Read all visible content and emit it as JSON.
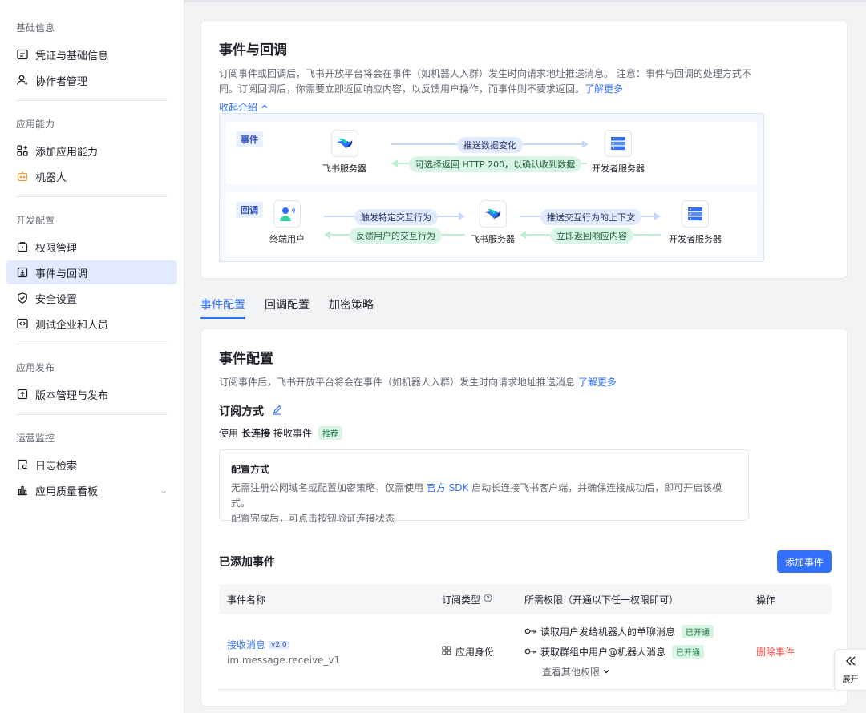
{
  "sidebar": {
    "groups": [
      {
        "title": "基础信息",
        "items": [
          {
            "label": "凭证与基础信息",
            "icon": "id-card-icon"
          },
          {
            "label": "协作者管理",
            "icon": "user-add-icon"
          }
        ]
      },
      {
        "title": "应用能力",
        "items": [
          {
            "label": "添加应用能力",
            "icon": "apps-add-icon"
          },
          {
            "label": "机器人",
            "icon": "robot-icon"
          }
        ]
      },
      {
        "title": "开发配置",
        "items": [
          {
            "label": "权限管理",
            "icon": "permission-icon"
          },
          {
            "label": "事件与回调",
            "icon": "event-icon",
            "active": true
          },
          {
            "label": "安全设置",
            "icon": "shield-icon"
          },
          {
            "label": "测试企业和人员",
            "icon": "code-icon"
          }
        ]
      },
      {
        "title": "应用发布",
        "items": [
          {
            "label": "版本管理与发布",
            "icon": "upload-icon"
          }
        ]
      },
      {
        "title": "运营监控",
        "items": [
          {
            "label": "日志检索",
            "icon": "log-search-icon"
          },
          {
            "label": "应用质量看板",
            "icon": "bar-chart-icon",
            "chevron": true
          }
        ]
      }
    ]
  },
  "intro": {
    "title": "事件与回调",
    "desc": "订阅事件或回调后，飞书开放平台将会在事件（如机器人入群）发生时向请求地址推送消息。 注意：事件与回调的处理方式不同。订阅回调后，你需要立即返回响应内容，以反馈用户操作，而事件则不要求返回。",
    "learn_more": "了解更多",
    "collapse": "收起介绍"
  },
  "diagram": {
    "event_tag": "事件",
    "callback_tag": "回调",
    "feishu_server": "飞书服务器",
    "dev_server": "开发者服务器",
    "end_user": "终端用户",
    "event_push": "推送数据变化",
    "event_return": "可选择返回 HTTP 200，以确认收到数据",
    "cb_trigger": "触发特定交互行为",
    "cb_feedback": "反馈用户的交互行为",
    "cb_push": "推送交互行为的上下文",
    "cb_return": "立即返回响应内容",
    "colors": {
      "blue_line": "#c9d8ff",
      "green_line": "#bfeed3"
    }
  },
  "tabs": [
    {
      "label": "事件配置",
      "active": true
    },
    {
      "label": "回调配置"
    },
    {
      "label": "加密策略"
    }
  ],
  "config": {
    "title": "事件配置",
    "sub": "订阅事件后，飞书开放平台将会在事件（如机器人入群）发生时向请求地址推送消息",
    "learn_more": "了解更多",
    "method_title": "订阅方式",
    "use_prefix": "使用",
    "use_mode": "长连接",
    "use_suffix": "接收事件",
    "recommend": "推荐",
    "box_title": "配置方式",
    "box_desc_1": "无需注册公网域名或配置加密策略，仅需使用",
    "box_sdk": "官方 SDK",
    "box_desc_2": "启动长连接飞书客户端，并确保连接成功后，即可开启该模式。",
    "box_desc_3": "配置完成后，可点击按钮验证连接状态",
    "added_title": "已添加事件",
    "add_button": "添加事件"
  },
  "table": {
    "headers": [
      "事件名称",
      "订阅类型",
      "所需权限（开通以下任一权限即可）",
      "操作"
    ],
    "rows": [
      {
        "name": "接收消息",
        "version": "v2.0",
        "code": "im.message.receive_v1",
        "type": "应用身份",
        "perms": [
          {
            "label": "读取用户发给机器人的单聊消息",
            "status": "已开通"
          },
          {
            "label": "获取群组中用户@机器人消息",
            "status": "已开通"
          }
        ],
        "more": "查看其他权限",
        "action": "删除事件"
      }
    ]
  },
  "expand": {
    "label": "展开"
  }
}
